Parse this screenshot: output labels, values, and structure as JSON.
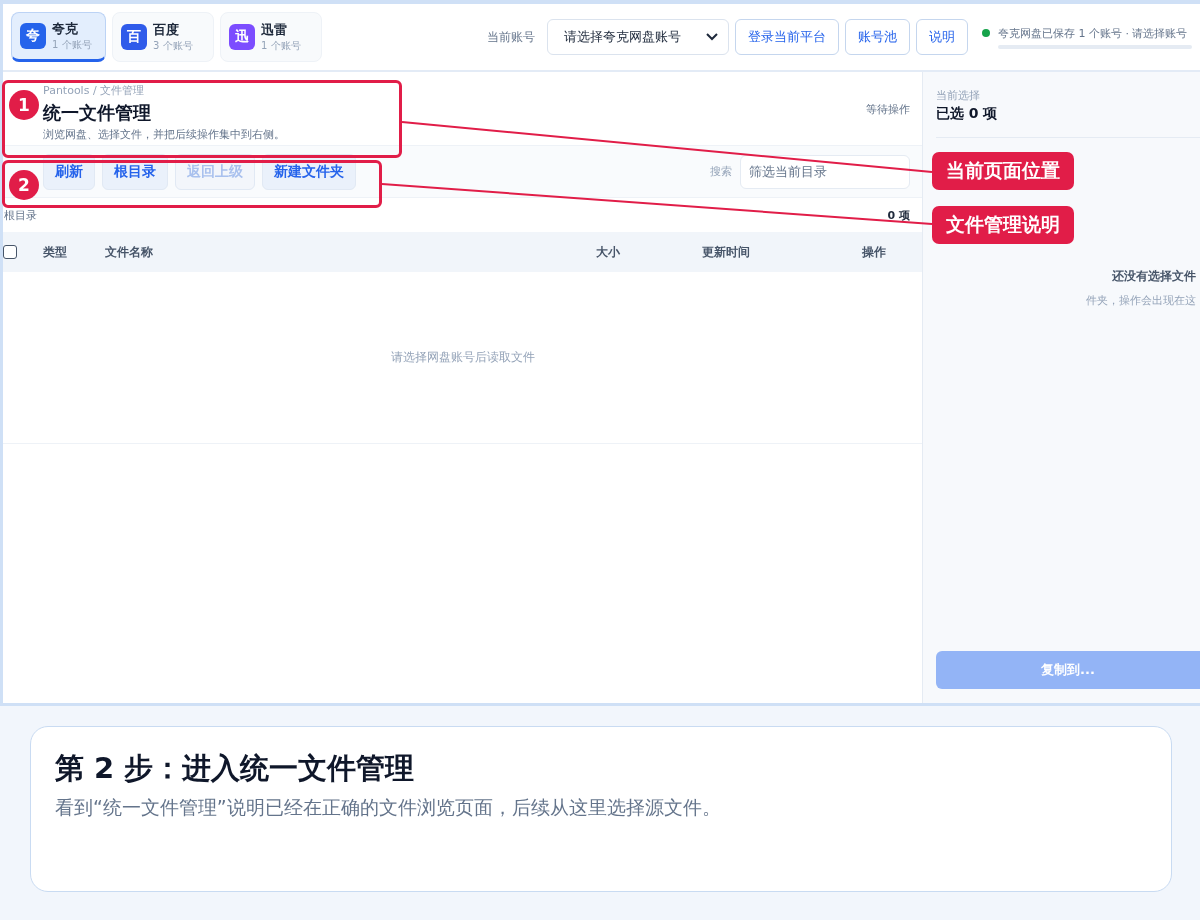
{
  "platforms": [
    {
      "icon": "夸",
      "name": "夸克",
      "count": "1 个账号",
      "color": "#2563eb",
      "selected": true
    },
    {
      "icon": "百",
      "name": "百度",
      "count": "3 个账号",
      "color": "#2f5bea",
      "selected": false
    },
    {
      "icon": "迅",
      "name": "迅雷",
      "count": "1 个账号",
      "color": "#7c4dff",
      "selected": false
    }
  ],
  "account": {
    "label": "当前账号",
    "value": "请选择夸克网盘账号"
  },
  "top_buttons": [
    "登录当前平台",
    "账号池",
    "说明"
  ],
  "status": {
    "text": "夸克网盘已保存 1 个账号 · 请选择账号",
    "color": "#16a34a"
  },
  "header": {
    "breadcrumb": "Pantools / 文件管理",
    "title": "统一文件管理",
    "description": "浏览网盘、选择文件，并把后续操作集中到右侧。",
    "state": "等待操作"
  },
  "toolbar": {
    "buttons": [
      {
        "label": "刷新",
        "disabled": false
      },
      {
        "label": "根目录",
        "disabled": false
      },
      {
        "label": "返回上级",
        "disabled": true
      },
      {
        "label": "新建文件夹",
        "disabled": false
      }
    ],
    "search_label": "搜索",
    "search_placeholder": "筛选当前目录"
  },
  "path": {
    "text": "根目录",
    "count": "0 项"
  },
  "table": {
    "select_all_checked": false,
    "columns": [
      "类型",
      "文件名称",
      "大小",
      "更新时间",
      "操作"
    ],
    "empty": "请选择网盘账号后读取文件"
  },
  "selection": {
    "label": "当前选择",
    "value": "已选 0 项",
    "empty_title": "还没有选择文件",
    "empty_text": "件夹，操作会出现在这",
    "action": "复制到...",
    "action_disabled": true
  },
  "annotations": [
    {
      "number": "1",
      "label": "当前页面位置"
    },
    {
      "number": "2",
      "label": "文件管理说明"
    }
  ],
  "step": {
    "title": "第 2 步：进入统一文件管理",
    "text": "看到“统一文件管理”说明已经在正确的文件浏览页面，后续从这里选择源文件。"
  }
}
